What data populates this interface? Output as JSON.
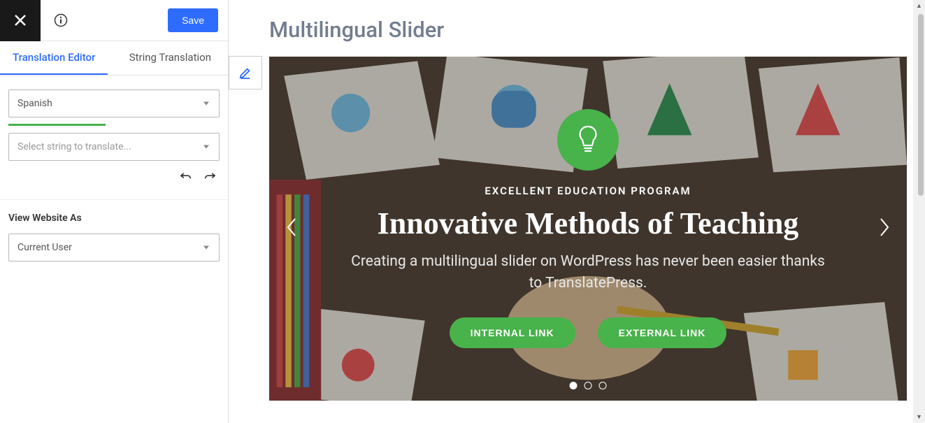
{
  "topbar": {
    "save_label": "Save"
  },
  "tabs": {
    "editor": "Translation Editor",
    "strings": "String Translation"
  },
  "language_select": {
    "value": "Spanish"
  },
  "string_select": {
    "placeholder": "Select string to translate..."
  },
  "view_as": {
    "label": "View Website As",
    "value": "Current User"
  },
  "preview": {
    "page_title": "Multilingual Slider",
    "slide": {
      "eyebrow": "EXCELLENT EDUCATION PROGRAM",
      "headline": "Innovative Methods of Teaching",
      "subcopy": "Creating a multilingual slider on WordPress has never been easier thanks to TranslatePress.",
      "btn_internal": "INTERNAL LINK",
      "btn_external": "EXTERNAL LINK"
    }
  },
  "icons": {
    "close": "close-icon",
    "info": "info-icon",
    "undo": "undo-icon",
    "redo": "redo-icon",
    "edit": "edit-icon",
    "lightbulb": "lightbulb-icon",
    "chevron_left": "chevron-left-icon",
    "chevron_right": "chevron-right-icon"
  },
  "colors": {
    "primary": "#2e6bff",
    "green": "#48b24b",
    "title": "#727d8e"
  }
}
